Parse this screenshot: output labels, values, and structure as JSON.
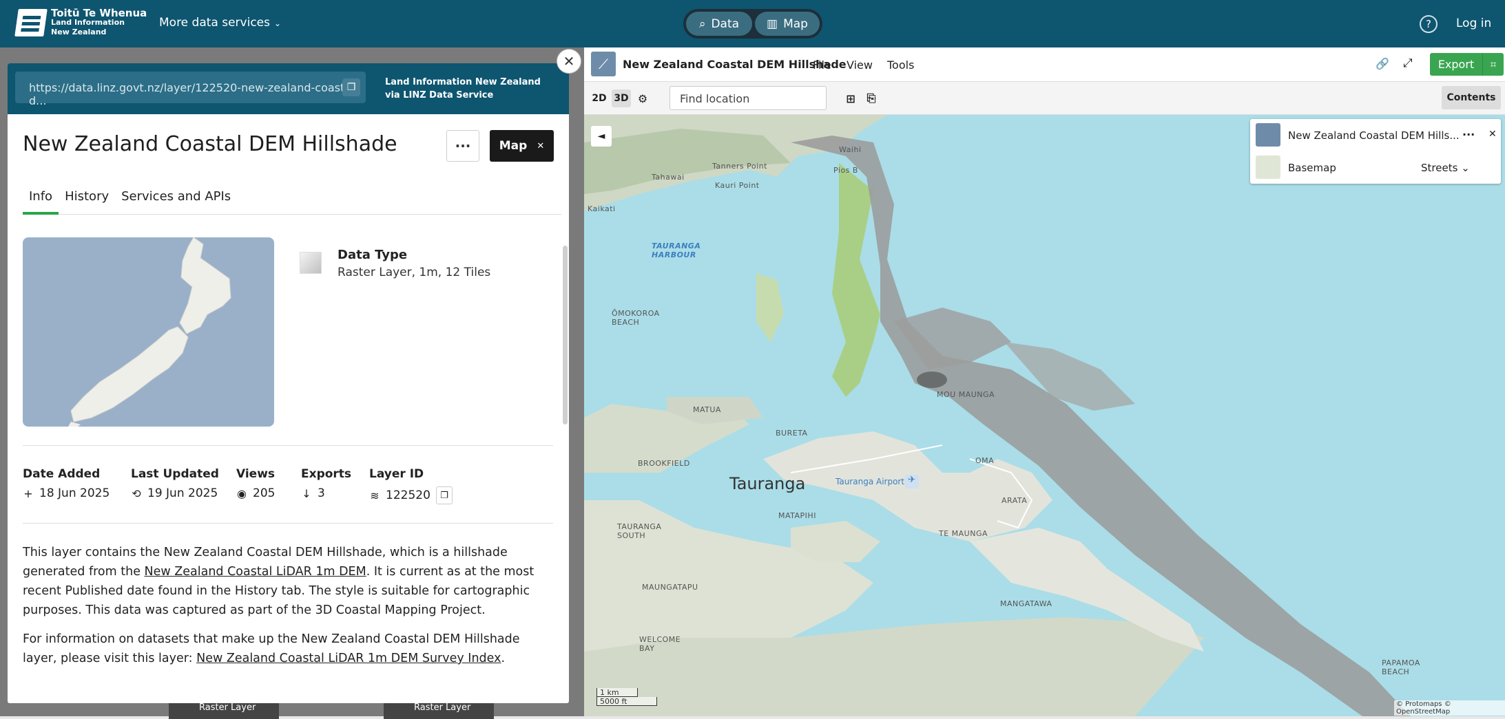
{
  "topbar": {
    "logo_line1": "Toitū Te Whenua",
    "logo_line2": "Land Information",
    "logo_line3": "New Zealand",
    "more_services": "More data services",
    "toggle_data": "Data",
    "toggle_map": "Map",
    "help_icon": "?",
    "login": "Log in"
  },
  "backdrop": {
    "card_label": "Raster Layer"
  },
  "panel": {
    "url": "https://data.linz.govt.nz/layer/122520-new-zealand-coastal-d...",
    "provider_line1": "Land Information New Zealand",
    "provider_line2": "via LINZ Data Service",
    "title": "New Zealand Coastal DEM Hillshade",
    "more_label": "···",
    "map_label": "Map",
    "map_close": "✕",
    "close": "✕",
    "tabs": [
      "Info",
      "History",
      "Services and APIs"
    ],
    "data_type_label": "Data Type",
    "data_type_value": "Raster Layer, 1m, 12 Tiles",
    "stats": [
      {
        "label": "Date Added",
        "icon": "+",
        "value": "18 Jun 2025"
      },
      {
        "label": "Last Updated",
        "icon": "⟲",
        "value": "19 Jun 2025"
      },
      {
        "label": "Views",
        "icon": "◉",
        "value": "205"
      },
      {
        "label": "Exports",
        "icon": "↓",
        "value": "3"
      },
      {
        "label": "Layer ID",
        "icon": "≋",
        "value": "122520"
      }
    ],
    "para1_a": "This layer contains the New Zealand Coastal DEM Hillshade, which is a hillshade generated from the ",
    "para1_link": "New Zealand Coastal LiDAR 1m DEM",
    "para1_b": ". It is current as at the most recent Published date found in the History tab. The style is suitable for cartographic purposes. This data was captured as part of the 3D Coastal Mapping Project.",
    "para2_a": "For information on datasets that make up the New Zealand Coastal DEM Hillshade layer, please visit this layer: ",
    "para2_link": "New Zealand Coastal LiDAR 1m DEM Survey Index",
    "para2_b": "."
  },
  "map_toolbar": {
    "title": "New Zealand Coastal DEM Hillshade",
    "menus": [
      "File",
      "View",
      "Tools"
    ],
    "export": "Export"
  },
  "map_tools": {
    "b2d": "2D",
    "b3d": "3D",
    "find_placeholder": "Find location",
    "contents": "Contents"
  },
  "legend": {
    "layer_name": "New Zealand Coastal DEM Hills...",
    "layer_more": "···",
    "layer_close": "✕",
    "basemap_label": "Basemap",
    "basemap_value": "Streets"
  },
  "map_labels": {
    "tauranga": "Tauranga",
    "airport": "Tauranga Airport",
    "harbour1": "TAURANGA",
    "harbour2": "HARBOUR",
    "matua": "MATUA",
    "bureta": "BURETA",
    "brookfield": "BROOKFIELD",
    "tauranga_south1": "TAURANGA",
    "tauranga_south2": "SOUTH",
    "matapihi": "MATAPIHI",
    "te_maunga": "TE MAUNGA",
    "maungatapu": "MAUNGATAPU",
    "mangatawa": "MANGATAWA",
    "welcome1": "WELCOME",
    "welcome2": "BAY",
    "papamoa1": "PAPAMOA",
    "papamoa2": "BEACH",
    "omokoroa1": "ŌMOKOROA",
    "omokoroa2": "BEACH",
    "tahawai": "Tahawai",
    "tanners": "Tanners Point",
    "kauri": "Kauri Point",
    "kaikati": "Kaikati",
    "pios": "Pios B",
    "waihi": "Waihi",
    "maunga": "MOU MAUNGA",
    "omanu": "OMA",
    "arataki": "ARATA"
  },
  "scale": {
    "km": "1 km",
    "ft": "5000 ft"
  },
  "attribution": "© Protomaps © OpenStreetMap"
}
